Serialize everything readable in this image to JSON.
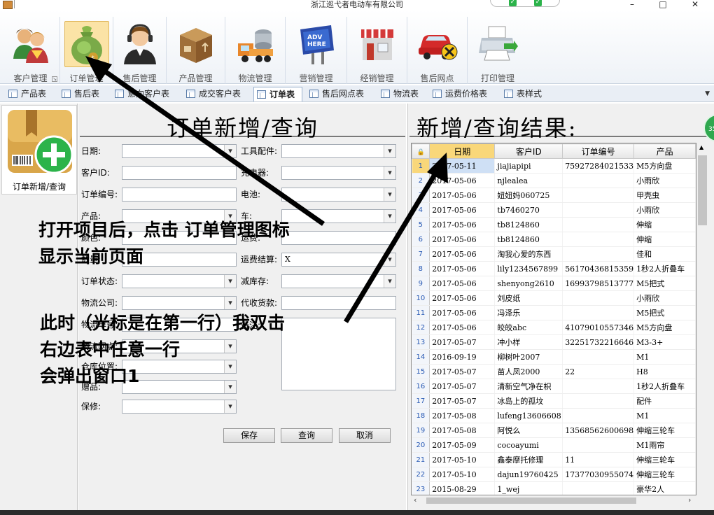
{
  "window": {
    "title": "浙江巡弋者电动车有限公司",
    "minimize": "–",
    "maximize": "□",
    "close": "✕"
  },
  "ribbon": [
    {
      "label": "客户管理",
      "icon": "customers-icon"
    },
    {
      "label": "订单管理",
      "icon": "money-bag-icon",
      "active": true
    },
    {
      "label": "售后管理",
      "icon": "headset-agent-icon"
    },
    {
      "label": "产品管理",
      "icon": "box-icon"
    },
    {
      "label": "物流管理",
      "icon": "truck-icon"
    },
    {
      "label": "营销管理",
      "icon": "billboard-icon"
    },
    {
      "label": "经销管理",
      "icon": "store-icon"
    },
    {
      "label": "售后网点",
      "icon": "car-repair-icon"
    },
    {
      "label": "打印管理",
      "icon": "printer-icon"
    }
  ],
  "tabs": [
    "产品表",
    "售后表",
    "意向客户表",
    "成交客户表",
    "订单表",
    "售后网点表",
    "物流表",
    "运费价格表",
    "表样式"
  ],
  "active_tab": "订单表",
  "leftnav": {
    "label": "订单新增/查询",
    "icon": "add-order-box-icon"
  },
  "form": {
    "title": "订单新增/查询",
    "left_fields": [
      {
        "label": "日期:",
        "type": "combo",
        "value": ""
      },
      {
        "label": "客户ID:",
        "type": "text",
        "value": ""
      },
      {
        "label": "订单编号:",
        "type": "text",
        "value": ""
      },
      {
        "label": "产品:",
        "type": "combo",
        "value": ""
      },
      {
        "label": "颜色:",
        "type": "text",
        "value": ""
      },
      {
        "label": "数量:",
        "type": "text",
        "value": ""
      },
      {
        "label": "订单状态:",
        "type": "combo",
        "value": ""
      },
      {
        "label": "物流公司:",
        "type": "combo",
        "value": ""
      },
      {
        "label": "物流单号:",
        "type": "text",
        "value": ""
      },
      {
        "label": "物流网点:",
        "type": "combo",
        "value": ""
      },
      {
        "label": "仓库位置:",
        "type": "combo",
        "value": ""
      },
      {
        "label": "赠品:",
        "type": "combo",
        "value": ""
      },
      {
        "label": "保修:",
        "type": "combo",
        "value": ""
      }
    ],
    "right_fields": [
      {
        "label": "工具配件:",
        "type": "combo",
        "value": ""
      },
      {
        "label": "充电器:",
        "type": "combo",
        "value": ""
      },
      {
        "label": "电池:",
        "type": "combo",
        "value": ""
      },
      {
        "label": "车:",
        "type": "combo",
        "value": ""
      },
      {
        "label": "运费:",
        "type": "text",
        "value": ""
      },
      {
        "label": "运费结算:",
        "type": "combo",
        "value": "X"
      },
      {
        "label": "减库存:",
        "type": "combo",
        "value": ""
      },
      {
        "label": "代收货款:",
        "type": "text",
        "value": ""
      },
      {
        "label": "备注:",
        "type": "textarea",
        "value": ""
      }
    ],
    "buttons": {
      "save": "保存",
      "query": "查询",
      "cancel": "取消"
    }
  },
  "results": {
    "title": "新增/查询结果:",
    "columns": [
      "日期",
      "客户ID",
      "订单编号",
      "产品"
    ],
    "rows": [
      [
        "2017-05-11",
        "jiajiapipi",
        "75927284021533",
        "M5方向盘"
      ],
      [
        "2017-05-06",
        "njlealea",
        "",
        "小雨欣"
      ],
      [
        "2017-05-06",
        "妞妞妈060725",
        "",
        "甲壳虫"
      ],
      [
        "2017-05-06",
        "tb7460270",
        "",
        "小雨欣"
      ],
      [
        "2017-05-06",
        "tb8124860",
        "",
        "伸缩"
      ],
      [
        "2017-05-06",
        "tb8124860",
        "",
        "伸缩"
      ],
      [
        "2017-05-06",
        "淘我心爱的东西",
        "",
        "佳和"
      ],
      [
        "2017-05-06",
        "lily1234567899",
        "56170436815359",
        "1秒2人折叠车"
      ],
      [
        "2017-05-06",
        "shenyong2610",
        "16993798513777",
        "M5把式"
      ],
      [
        "2017-05-06",
        "刘皮纸",
        "",
        "小雨欣"
      ],
      [
        "2017-05-06",
        "冯泽乐",
        "",
        "M5把式"
      ],
      [
        "2017-05-06",
        "皎皎abc",
        "41079010557346",
        "M5方向盘"
      ],
      [
        "2017-05-07",
        "冲小样",
        "32251732216646",
        "M3-3+"
      ],
      [
        "2016-09-19",
        "柳树叶2007",
        "",
        "M1"
      ],
      [
        "2017-05-07",
        "苗人凤2000",
        "22",
        "H8"
      ],
      [
        "2017-05-07",
        "清新空气净在枳",
        "",
        "1秒2人折叠车"
      ],
      [
        "2017-05-07",
        "冰岛上的孤坟",
        "",
        "配件"
      ],
      [
        "2017-05-08",
        "lufeng13606608",
        "",
        "M1"
      ],
      [
        "2017-05-08",
        "阿悦么",
        "13568562600698",
        "伸缩三轮车"
      ],
      [
        "2017-05-09",
        "cocoayumi",
        "",
        "M1雨帘"
      ],
      [
        "2017-05-10",
        "鑫泰摩托修理",
        "11",
        "伸缩三轮车"
      ],
      [
        "2017-05-10",
        "dajun19760425",
        "17377030955074",
        "伸缩三轮车"
      ],
      [
        "2015-08-29",
        "1_wej",
        "",
        "豪华2人"
      ]
    ]
  },
  "annotations": {
    "text1_line1": "打开项目后，点击 订单管理图标",
    "text1_line2": "显示当前页面",
    "text2_line1": "此时（光标是在第一行）我双击",
    "text2_line2": "右边表中任意一行",
    "text2_line3": "会弹出窗口1"
  },
  "badge": "35"
}
